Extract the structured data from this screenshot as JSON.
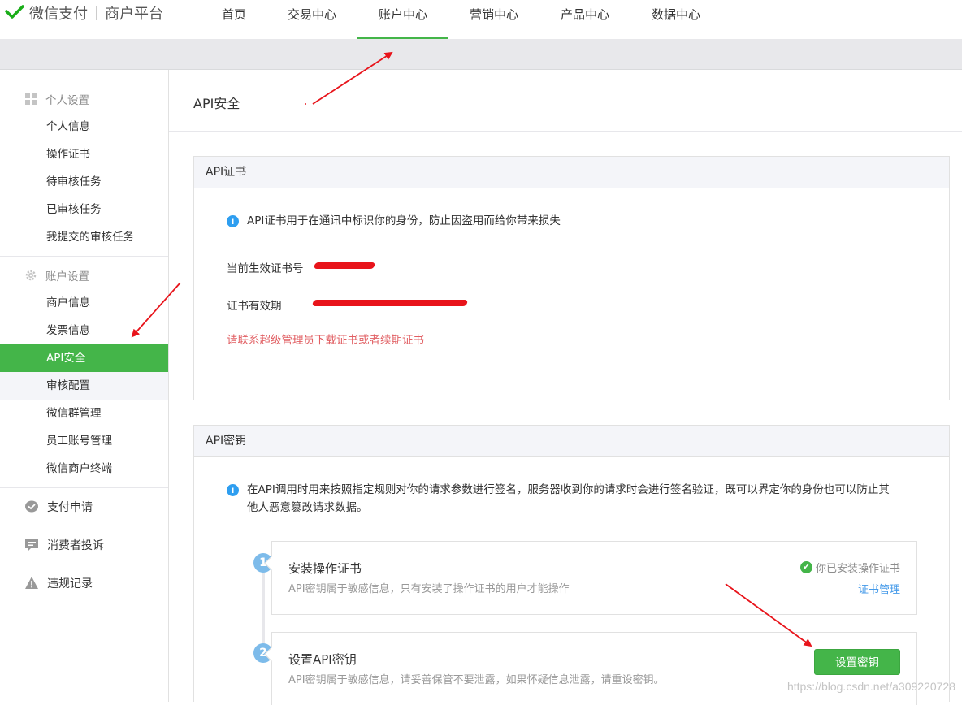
{
  "brand": {
    "name": "微信支付",
    "sub": "商户平台"
  },
  "nav": [
    {
      "label": "首页"
    },
    {
      "label": "交易中心"
    },
    {
      "label": "账户中心"
    },
    {
      "label": "营销中心"
    },
    {
      "label": "产品中心"
    },
    {
      "label": "数据中心"
    }
  ],
  "sidebar": {
    "personal": {
      "title": "个人设置",
      "items": [
        "个人信息",
        "操作证书",
        "待审核任务",
        "已审核任务",
        "我提交的审核任务"
      ]
    },
    "account": {
      "title": "账户设置",
      "items": [
        "商户信息",
        "发票信息",
        "API安全",
        "审核配置",
        "微信群管理",
        "员工账号管理",
        "微信商户终端"
      ]
    },
    "pay_apply": "支付申请",
    "consumer_complaint": "消费者投诉",
    "violation": "违规记录"
  },
  "page": {
    "title": "API安全"
  },
  "cert_panel": {
    "title": "API证书",
    "info": "API证书用于在通讯中标识你的身份，防止因盗用而给你带来损失",
    "current_label": "当前生效证书号",
    "validity_label": "证书有效期",
    "note": "请联系超级管理员下载证书或者续期证书"
  },
  "key_panel": {
    "title": "API密钥",
    "info_line1": "在API调用时用来按照指定规则对你的请求参数进行签名，服务器收到你的请求时会进行签名验证，既可以界定你的身份也可以防止其",
    "info_line2": "他人恶意篡改请求数据。",
    "steps": [
      {
        "num": "1",
        "title": "安装操作证书",
        "desc": "API密钥属于敏感信息，只有安装了操作证书的用户才能操作",
        "status": "你已安装操作证书",
        "link": "证书管理"
      },
      {
        "num": "2",
        "title": "设置API密钥",
        "desc": "API密钥属于敏感信息，请妥善保管不要泄露，如果怀疑信息泄露，请重设密钥。",
        "button": "设置密钥"
      }
    ]
  },
  "watermark": "https://blog.csdn.net/a309220728",
  "colors": {
    "accent": "#44b549",
    "info": "#2e9ef0",
    "link": "#459ae9",
    "warn": "#e15f63",
    "annotation": "#e8141b"
  }
}
